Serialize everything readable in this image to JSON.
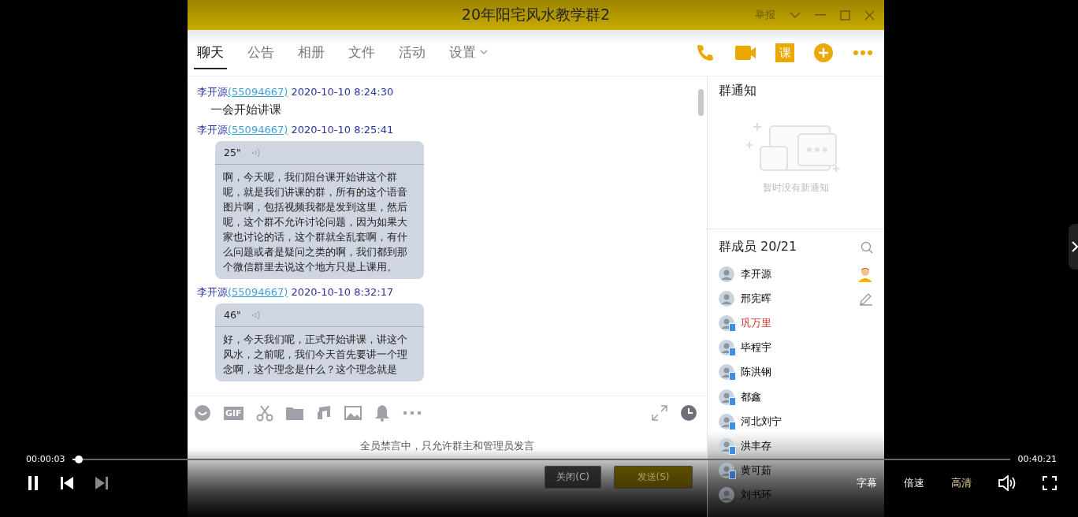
{
  "window": {
    "title": "20年阳宅风水教学群2",
    "report": "举报"
  },
  "header_icons": {
    "course": "课"
  },
  "input_tools": {
    "gif": "GIF"
  },
  "tabs": [
    {
      "label": "聊天",
      "selected": true
    },
    {
      "label": "公告",
      "selected": false
    },
    {
      "label": "相册",
      "selected": false
    },
    {
      "label": "文件",
      "selected": false
    },
    {
      "label": "活动",
      "selected": false
    },
    {
      "label": "设置",
      "selected": false,
      "dropdown": true
    }
  ],
  "messages": [
    {
      "kind": "text",
      "sender": "李开源",
      "qq": "(55094667)",
      "time": "2020-10-10 8:24:30",
      "text": "一会开始讲课"
    },
    {
      "kind": "voice",
      "sender": "李开源",
      "qq": "(55094667)",
      "time": "2020-10-10 8:25:41",
      "duration": "25\"",
      "text": "啊，今天呢，我们阳台课开始讲这个群呢，就是我们讲课的群，所有的这个语音图片啊，包括视频我都是发到这里，然后呢，这个群不允许讨论问题，因为如果大家也讨论的话，这个群就全乱套啊，有什么问题或者是疑问之类的啊，我们都到那个微信群里去说这个地方只是上课用。"
    },
    {
      "kind": "voice",
      "sender": "李开源",
      "qq": "(55094667)",
      "time": "2020-10-10 8:32:17",
      "duration": "46\"",
      "text": "好，今天我们呢，正式开始讲课，讲这个风水，之前呢，我们今天首先要讲一个理念啊，这个理念是什么？这个理念就是"
    }
  ],
  "muted_notice": "全员禁言中，只允许群主和管理员发言",
  "buttons": [
    {
      "label": "关闭(C)",
      "disabled": false
    },
    {
      "label": "发送(S)",
      "disabled": true
    }
  ],
  "notice": {
    "title": "群通知",
    "empty": "暂时没有新通知"
  },
  "members": {
    "title": "群成员 20/21",
    "items": [
      {
        "name": "李开源",
        "kind": "owner",
        "mobile": false,
        "highlighted": false
      },
      {
        "name": "邢宪晖",
        "kind": "admin",
        "mobile": false,
        "highlighted": false
      },
      {
        "name": "巩万里",
        "kind": "member",
        "mobile": true,
        "highlighted": true
      },
      {
        "name": "毕程宇",
        "kind": "member",
        "mobile": true,
        "highlighted": false
      },
      {
        "name": "陈洪钢",
        "kind": "member",
        "mobile": true,
        "highlighted": false
      },
      {
        "name": "都鑫",
        "kind": "member",
        "mobile": true,
        "highlighted": false
      },
      {
        "name": "河北刘宁",
        "kind": "member",
        "mobile": true,
        "highlighted": false
      },
      {
        "name": "洪丰存",
        "kind": "member",
        "mobile": true,
        "highlighted": false
      },
      {
        "name": "黄可茹",
        "kind": "member",
        "mobile": true,
        "highlighted": false
      },
      {
        "name": "刘书环",
        "kind": "member",
        "mobile": false,
        "highlighted": false
      }
    ]
  },
  "player": {
    "current": "00:00:03",
    "total": "00:40:21",
    "level": 0.002,
    "playing": true,
    "options": [
      {
        "label": "字幕",
        "selected": false
      },
      {
        "label": "倍速",
        "selected": false
      },
      {
        "label": "高清",
        "selected": true
      }
    ]
  }
}
